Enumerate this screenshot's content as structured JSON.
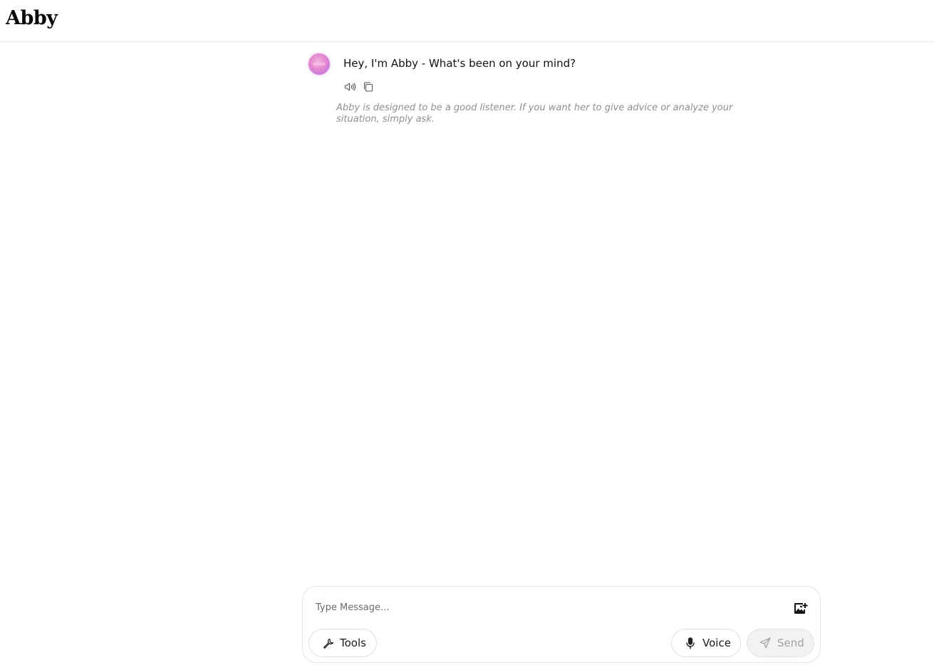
{
  "header": {
    "logo": "Abby"
  },
  "chat": {
    "messages": [
      {
        "sender": "Abby",
        "text": "Hey, I'm Abby - What's been on your mind?",
        "actions": [
          {
            "icon": "speaker-icon"
          },
          {
            "icon": "copy-icon"
          }
        ]
      }
    ],
    "disclaimer": "Abby is designed to be a good listener. If you want her to give advice or analyze your situation, simply ask."
  },
  "composer": {
    "placeholder": "Type Message...",
    "value": "",
    "image_icon": "add-image-icon",
    "tools_label": "Tools",
    "tools_icon": "wrench-icon",
    "voice_label": "Voice",
    "voice_icon": "microphone-icon",
    "send_label": "Send",
    "send_icon": "send-icon",
    "send_disabled": true
  },
  "colors": {
    "disclaimer_text": "#8d8f95",
    "border": "#e3e3e3",
    "send_disabled_bg": "#f2f2f2",
    "send_disabled_text": "#a0a0a0"
  }
}
